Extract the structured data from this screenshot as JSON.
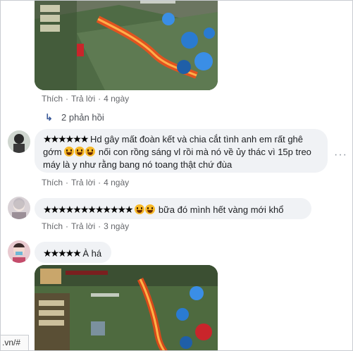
{
  "comment1": {
    "actions": {
      "like": "Thích",
      "reply": "Trả lời",
      "time": "4 ngày"
    }
  },
  "replies_link": {
    "icon": "reply-arrow-icon",
    "label": "2 phản hồi"
  },
  "comment2": {
    "name": "★★★★★★",
    "text": "Hd gây mất đoàn kết và chia cắt tình anh em rất ghê gớm",
    "text2": "nối con rồng sáng vl rồi mà nó về ủy thác vì 15p treo máy là y như rằng bang nó toang thật chứ đùa",
    "emojis": [
      "grinning-sweat",
      "grinning-sweat",
      "grinning-sweat"
    ],
    "actions": {
      "like": "Thích",
      "reply": "Trả lời",
      "time": "4 ngày"
    },
    "more": "···"
  },
  "comment3": {
    "name": "★★★★★★★★★★★★",
    "emojis": [
      "crying",
      "crying"
    ],
    "text": "bữa đó mình hết vàng mới khổ",
    "actions": {
      "like": "Thích",
      "reply": "Trả lời",
      "time": "3 ngày"
    }
  },
  "comment4": {
    "name": "★★★★★",
    "text": "À há"
  },
  "status_bar": {
    "url": ".vn/#"
  },
  "colors": {
    "bubble": "#f0f2f5",
    "meta": "#65676b",
    "link": "#385898"
  }
}
